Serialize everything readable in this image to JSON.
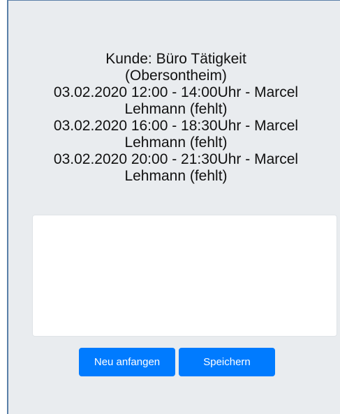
{
  "customer": {
    "heading": "Kunde: Büro Tätigkeit",
    "location": "(Obersontheim)"
  },
  "appointments": [
    {
      "time": "03.02.2020 12:00 - 14:00Uhr - Marcel",
      "person": "Lehmann (fehlt)"
    },
    {
      "time": "03.02.2020 16:00 - 18:30Uhr - Marcel",
      "person": "Lehmann (fehlt)"
    },
    {
      "time": "03.02.2020 20:00 - 21:30Uhr - Marcel",
      "person": "Lehmann (fehlt)"
    }
  ],
  "notes": {
    "value": ""
  },
  "actions": {
    "restart_label": "Neu anfangen",
    "save_label": "Speichern"
  },
  "colors": {
    "panel_bg": "#e9ecef",
    "primary": "#007bff",
    "border_accent": "#5a7fa8"
  }
}
